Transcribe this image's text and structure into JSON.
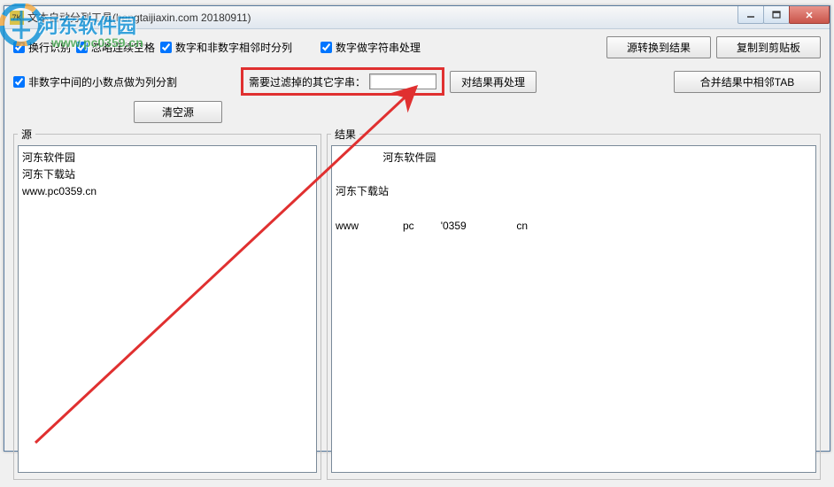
{
  "window": {
    "title": "文本自动分列工具(hengtaijiaxin.com 20180911)"
  },
  "row1": {
    "cb1": "换行识别",
    "cb2": "忽略连续空格",
    "cb3": "数字和非数字相邻时分列",
    "cb4": "数字做字符串处理",
    "btn_convert": "源转换到结果",
    "btn_copy": "复制到剪贴板"
  },
  "row2": {
    "cb5": "非数字中间的小数点做为列分割",
    "filter_label": "需要过滤掉的其它字串：",
    "filter_value": "",
    "btn_reprocess": "对结果再处理",
    "btn_merge": "合并结果中相邻TAB",
    "btn_clear": "清空源"
  },
  "panels": {
    "src_legend": "源",
    "res_legend": "结果",
    "src_text": "河东软件园\n河东下载站\nwww.pc0359.cn",
    "res_text": "                河东软件园\n\n河东下载站\n\nwww               pc         '0359                 cn"
  },
  "watermark": {
    "big": "河东软件园",
    "small": "www.pc0359.cn"
  }
}
